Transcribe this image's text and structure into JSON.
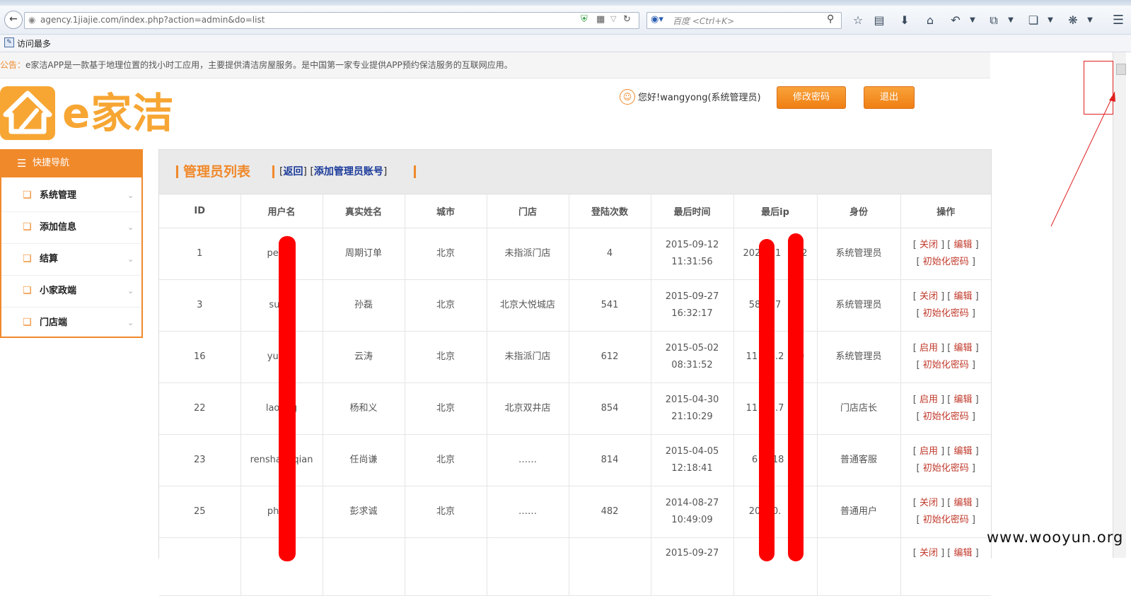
{
  "browser": {
    "url": "agency.1jiajie.com/index.php?action=admin&do=list",
    "search_placeholder": "百度 <Ctrl+K>",
    "bookmark_label": "访问最多"
  },
  "notice": {
    "label": "公告：",
    "text": "e家洁APP是一款基于地理位置的找小时工应用，主要提供清洁房屋服务。是中国第一家专业提供APP预约保洁服务的互联网应用。"
  },
  "logo": {
    "text": "e家洁"
  },
  "header": {
    "greeting": "您好!wangyong(系统管理员)",
    "change_password": "修改密码",
    "logout": "退出"
  },
  "sidebar": {
    "title": "快捷导航",
    "items": [
      {
        "label": "系统管理"
      },
      {
        "label": "添加信息"
      },
      {
        "label": "结算"
      },
      {
        "label": "小家政端"
      },
      {
        "label": "门店端"
      }
    ]
  },
  "panel": {
    "title": "管理员列表",
    "back": "返回",
    "add": "添加管理员账号"
  },
  "table": {
    "columns": [
      "ID",
      "用户名",
      "真实姓名",
      "城市",
      "门店",
      "登陆次数",
      "最后时间",
      "最后ip",
      "身份",
      "操作"
    ],
    "rows": [
      {
        "id": "1",
        "username": "pe    d",
        "realname": "周期订单",
        "city": "北京",
        "store": "未指派门店",
        "logins": "4",
        "date": "2015-09-12",
        "time": "11:31:56",
        "ip": "202  0.1   182",
        "role": "系统管理员",
        "op1": "关闭",
        "op2": "编辑",
        "op3": "初始化密码"
      },
      {
        "id": "3",
        "username": "su    i",
        "realname": "孙磊",
        "city": "北京",
        "store": "北京大悦城店",
        "logins": "541",
        "date": "2015-09-27",
        "time": "16:32:17",
        "ip": "58  5.7   08",
        "role": "系统管理员",
        "op1": "关闭",
        "op2": "编辑",
        "op3": "初始化密码"
      },
      {
        "id": "16",
        "username": "yu    o",
        "realname": "云涛",
        "city": "北京",
        "store": "未指派门店",
        "logins": "612",
        "date": "2015-05-02",
        "time": "08:31:52",
        "ip": "11  46.2   89",
        "role": "系统管理员",
        "op1": "启用",
        "op2": "编辑",
        "op3": "初始化密码"
      },
      {
        "id": "22",
        "username": "lao    g",
        "realname": "杨和义",
        "city": "北京",
        "store": "北京双井店",
        "logins": "854",
        "date": "2015-04-30",
        "time": "21:10:29",
        "ip": "11  51.7   01",
        "role": "门店店长",
        "op1": "启用",
        "op2": "编辑",
        "op3": "初始化密码"
      },
      {
        "id": "23",
        "username": "rensha    qian",
        "realname": "任尚谦",
        "city": "北京",
        "store": "……",
        "logins": "814",
        "date": "2015-04-05",
        "time": "12:18:41",
        "ip": "6  3.18   1",
        "role": "普通客服",
        "op1": "启用",
        "op2": "编辑",
        "op3": "初始化密码"
      },
      {
        "id": "25",
        "username": "ph    c",
        "realname": "彭求诚",
        "city": "北京",
        "store": "……",
        "logins": "482",
        "date": "2014-08-27",
        "time": "10:49:09",
        "ip": "20  00.   90",
        "role": "普通用户",
        "op1": "关闭",
        "op2": "编辑",
        "op3": "初始化密码"
      },
      {
        "id": "",
        "username": "",
        "realname": "",
        "city": "",
        "store": "",
        "logins": "",
        "date": "2015-09-27",
        "time": "",
        "ip": "",
        "role": "",
        "op1": "关闭",
        "op2": "编辑",
        "op3": ""
      }
    ]
  },
  "watermark": "www.wooyun.org",
  "colors": {
    "accent": "#f0892a",
    "link": "#1a3a9a",
    "op_link": "#c0392b",
    "redaction": "#ff0000"
  },
  "icons": [
    "back-arrow-icon",
    "globe-icon",
    "shield-icon",
    "qr-icon",
    "reload-icon",
    "paw-icon",
    "search-icon",
    "star-icon",
    "clipboard-icon",
    "download-icon",
    "home-icon",
    "undo-icon",
    "crop-icon",
    "window-icon",
    "bug-icon",
    "menu-icon",
    "user-icon",
    "list-icon",
    "document-icon",
    "chevron-down-icon"
  ]
}
